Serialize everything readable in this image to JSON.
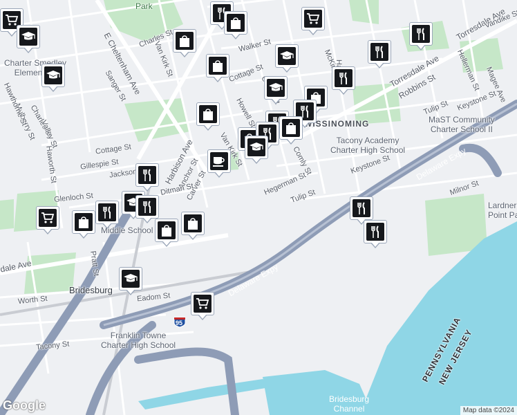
{
  "map": {
    "colors": {
      "land": "#eef0f3",
      "park": "#c6e7c8",
      "water": "#8fd6e6",
      "road": "#ffffff",
      "freeway": "#8e9cb6",
      "rail": "#c9ccd2"
    },
    "labels": {
      "park_top": "Park",
      "sanger_st": "Sanger St",
      "charles_st": "Charles St",
      "charles_st_2": "Charles St",
      "van_kirk_st": "Van Kirk St",
      "van_kirk_st_2": "Van Kirk St",
      "e_cheltenham_ave": "E Cheltenham Ave",
      "cottage_st": "Cottage St",
      "cottage_st_2": "Cottage St",
      "walker_st": "Walker St",
      "hale_st": "Hale St",
      "mckinley": "McKinley",
      "robbins_st": "Robbins St",
      "torresdale_ave": "Torresdale Ave",
      "torresdale_ave_2": "Torresdale Ave",
      "vandike_st": "Vandike St",
      "hellerman_st": "Hellerman St",
      "magee_ave": "Magee Ave",
      "keystone_st": "Keystone St",
      "keystone_st_2": "Keystone St",
      "tulip_st": "Tulip St",
      "tulip_st_2": "Tulip St",
      "howell_st": "Howell St",
      "comly_st": "Comly St",
      "comly_st_2": "Comly St",
      "hegerman_st": "Hegerman St",
      "harbison_ave": "Harbison Ave",
      "anchor_st": "Anchor St",
      "carver_st": "Carver St",
      "ditman_st": "Ditman St",
      "gillespie_st": "Gillespie St",
      "jackson_st": "Jackson St",
      "glenloch_st": "Glenloch St",
      "mulberry_st": "Mulberry St",
      "hawthorne_st": "Hawthorne St",
      "valley_st": "Valley St",
      "haworth_st": "Haworth St",
      "pratt_st": "Pratt St",
      "worth_st": "Worth St",
      "eadom_st": "Eadom St",
      "tacony_st": "Tacony St",
      "milnor_st": "Milnor St",
      "dale_ave": "dale Ave",
      "delaware_expy": "Delaware Expy",
      "delaware_expy_2": "Delaware Expy",
      "wissinoming": "WISSINOMING",
      "tacony_academy": "Tacony Academy\nCharter High School",
      "mast": "MaST Community\nCharter School II",
      "charter_smedley": "Charter Smedley\nElementary",
      "middle_school": "Middle School",
      "franklin_towne": "Franklin Towne\nCharter High School",
      "lardner_point": "Lardner\nPoint Pa",
      "bridesburg": "Bridesburg",
      "bridesburg_channel": "Bridesburg\nChannel",
      "pennsylvania": "PENNSYLVANIA",
      "new_jersey": "NEW JERSEY",
      "interstate": "95"
    },
    "google_logo": "Google",
    "attribution": "Map data ©2024"
  },
  "markers": [
    {
      "icon": "shopping-cart-icon"
    },
    {
      "icon": "graduation-cap-icon"
    },
    {
      "icon": "graduation-cap-icon"
    },
    {
      "icon": "utensils-icon"
    },
    {
      "icon": "shopping-bag-icon"
    },
    {
      "icon": "shopping-bag-icon"
    },
    {
      "icon": "shopping-cart-icon"
    },
    {
      "icon": "utensils-icon"
    },
    {
      "icon": "utensils-icon"
    },
    {
      "icon": "graduation-cap-icon"
    },
    {
      "icon": "shopping-bag-icon"
    },
    {
      "icon": "utensils-icon"
    },
    {
      "icon": "graduation-cap-icon"
    },
    {
      "icon": "shopping-bag-icon"
    },
    {
      "icon": "utensils-icon"
    },
    {
      "icon": "shopping-bag-icon"
    },
    {
      "icon": "utensils-icon"
    },
    {
      "icon": "shopping-bag-icon"
    },
    {
      "icon": "shopping-bag-icon"
    },
    {
      "icon": "utensils-icon"
    },
    {
      "icon": "graduation-cap-icon"
    },
    {
      "icon": "coffee-cup-icon"
    },
    {
      "icon": "utensils-icon"
    },
    {
      "icon": "utensils-icon"
    },
    {
      "icon": "graduation-cap-icon"
    },
    {
      "icon": "utensils-icon"
    },
    {
      "icon": "shopping-cart-icon"
    },
    {
      "icon": "shopping-bag-icon"
    },
    {
      "icon": "shopping-bag-icon"
    },
    {
      "icon": "shopping-bag-icon"
    },
    {
      "icon": "utensils-icon"
    },
    {
      "icon": "utensils-icon"
    },
    {
      "icon": "graduation-cap-icon"
    },
    {
      "icon": "shopping-cart-icon"
    }
  ]
}
